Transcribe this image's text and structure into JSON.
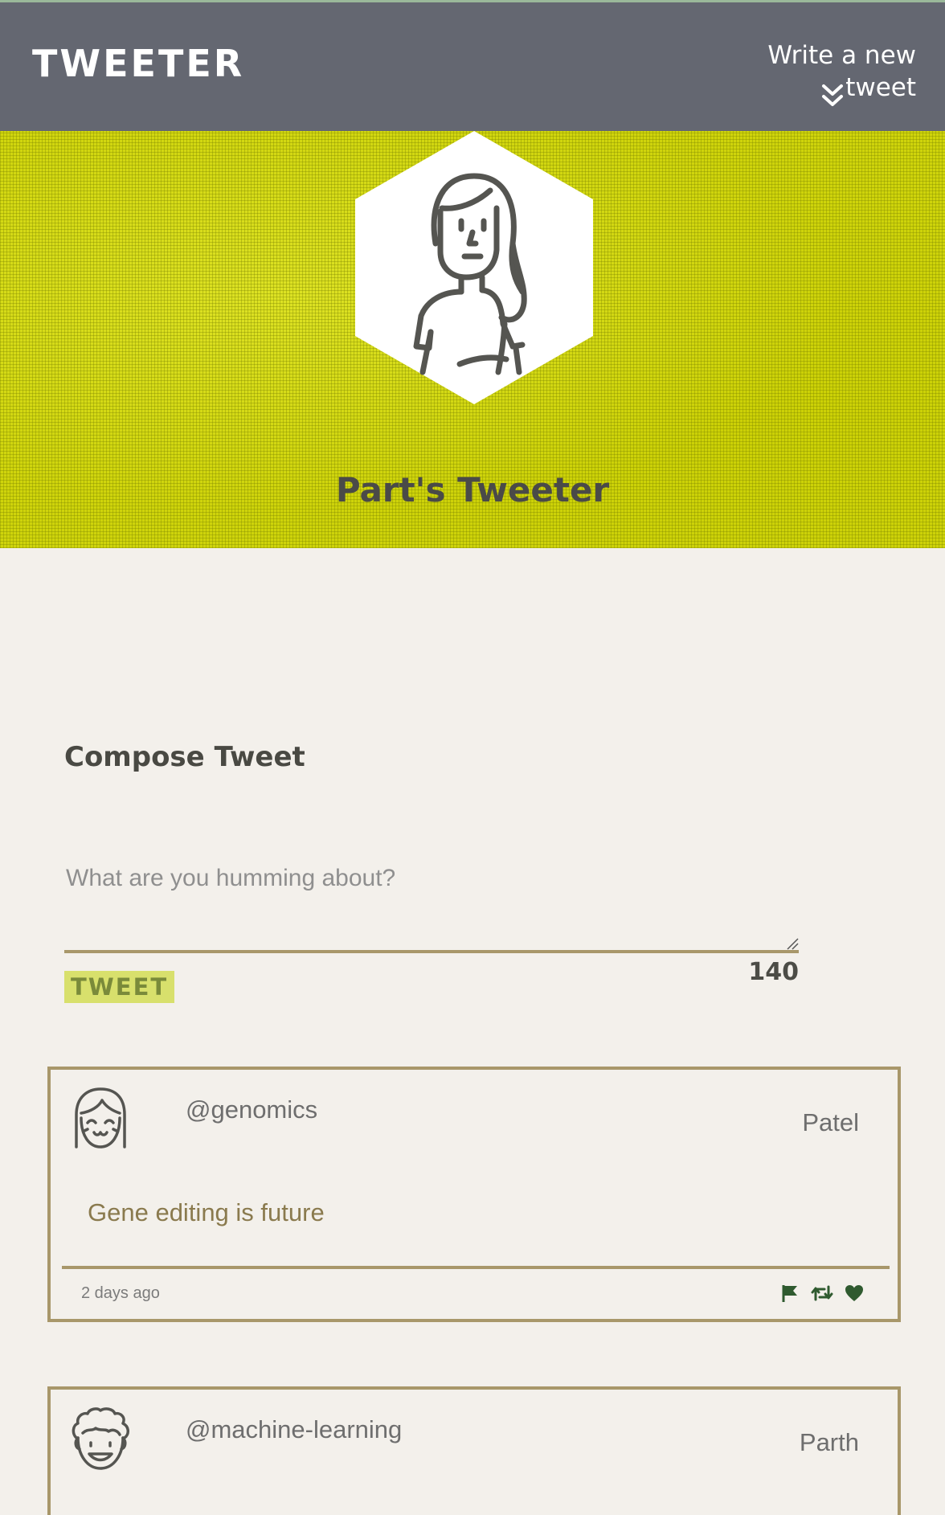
{
  "nav": {
    "brand": "TWEETER",
    "compose_toggle": "Write a new tweet",
    "chevron_icon": "double-chevron-down-icon"
  },
  "profile": {
    "name": "Part's Tweeter",
    "avatar_icon": "woman-avatar-icon"
  },
  "compose": {
    "title": "Compose Tweet",
    "placeholder": "What are you humming about?",
    "value": "",
    "submit_label": "TWEET",
    "char_count": "140"
  },
  "tweets": [
    {
      "handle": "@genomics",
      "name": "Patel",
      "content": "Gene editing is future",
      "time": "2 days ago",
      "avatar_icon": "girl-avatar-icon",
      "actions": [
        "flag-icon",
        "retweet-icon",
        "heart-icon"
      ]
    },
    {
      "handle": "@machine-learning",
      "name": "Parth",
      "avatar_icon": "curly-hair-avatar-icon"
    }
  ],
  "colors": {
    "nav_bg": "#646771",
    "header_bg": "#cfd40b",
    "page_bg": "#f3f0eb",
    "border": "#a8976a",
    "action_icons": "#2f5a2f",
    "tweet_button_bg": "#d8e06c"
  }
}
